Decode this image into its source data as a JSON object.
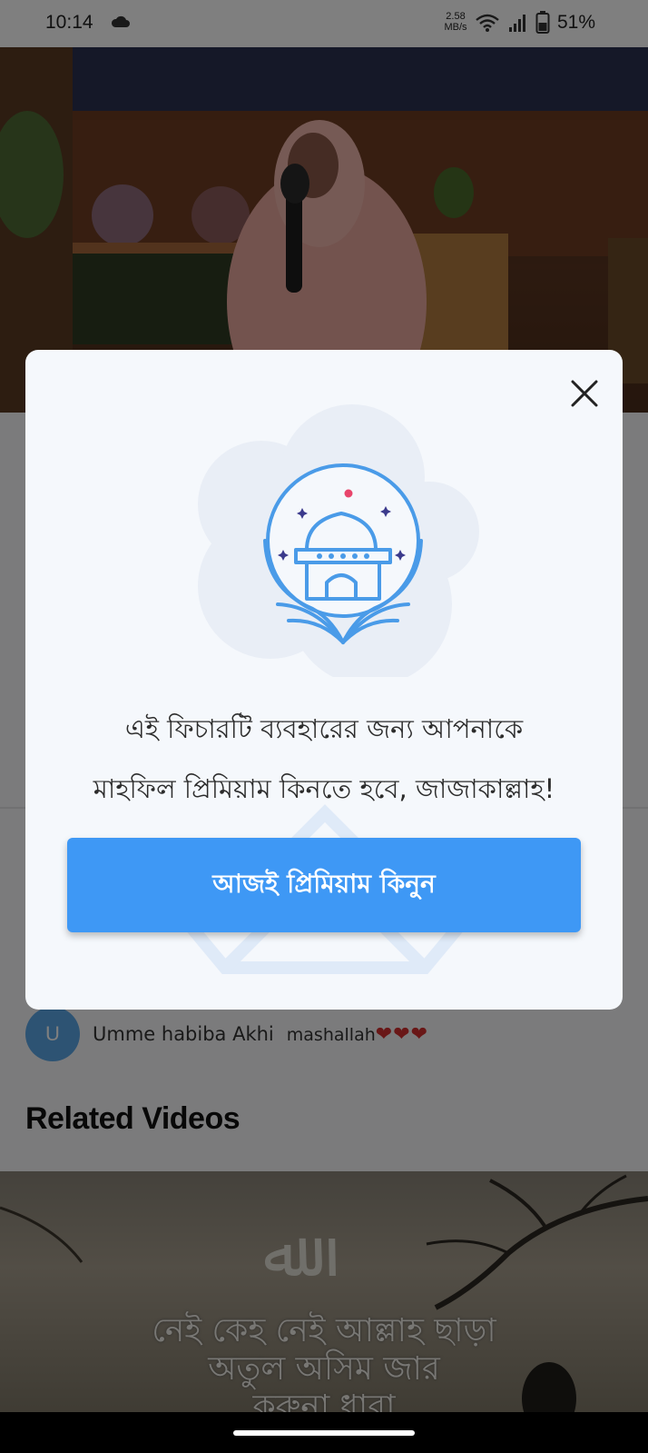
{
  "status_bar": {
    "time": "10:14",
    "speed_value": "2.58",
    "speed_unit": "MB/s",
    "battery": "51%"
  },
  "comment": {
    "avatar_letter": "U",
    "author": "Umme habiba Akhi",
    "text": "mashallah",
    "hearts": "❤❤❤"
  },
  "related": {
    "title": "Related Videos",
    "thumb_lines": [
      "নেই কেহ নেই আল্লাহ ছাড়া",
      "অতুল অসিম জার",
      "করুনা ধারা"
    ]
  },
  "modal": {
    "message_line1": "এই ফিচারটি ব্যবহারের জন্য আপনাকে",
    "message_line2": "মাহফিল প্রিমিয়াম কিনতে হবে, জাজাকাল্লাহ!",
    "buy_label": "আজই প্রিমিয়াম কিনুন",
    "close_icon": "close-icon",
    "illustration": "mosque-crescent-icon"
  },
  "colors": {
    "accent": "#3e98f5",
    "illustration_blue": "#4a9be8",
    "crescent": "#e8456b",
    "stars": "#3b3a8c"
  }
}
